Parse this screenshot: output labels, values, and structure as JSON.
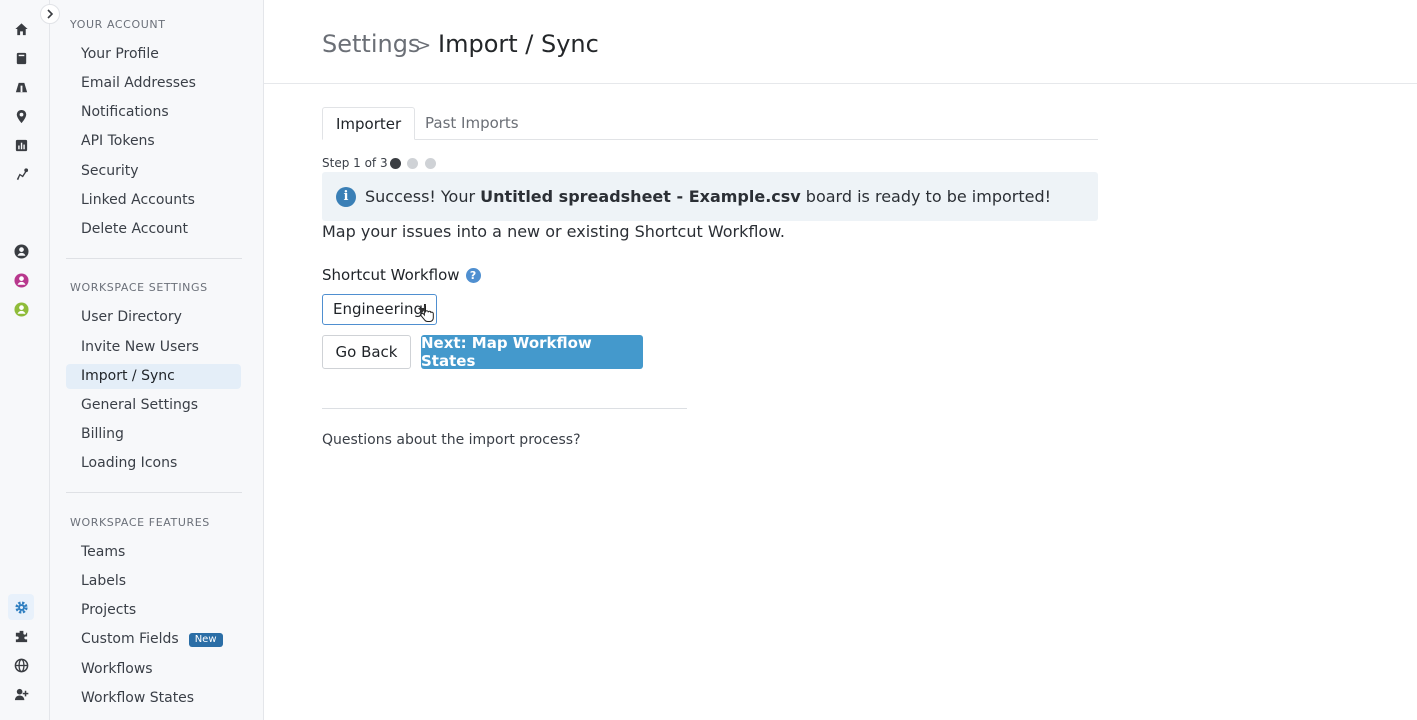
{
  "rail": {
    "icons": [
      "home-icon",
      "stories-icon",
      "epics-icon",
      "milestones-icon",
      "reports-icon",
      "roadmap-icon",
      "team-user-icon",
      "pink-user-icon",
      "green-user-icon",
      "settings-icon",
      "integrations-icon",
      "globe-icon",
      "invite-user-icon"
    ],
    "active_icon": "settings-icon"
  },
  "sidebar": {
    "your_account": {
      "title": "YOUR ACCOUNT",
      "items": [
        "Your Profile",
        "Email Addresses",
        "Notifications",
        "API Tokens",
        "Security",
        "Linked Accounts",
        "Delete Account"
      ]
    },
    "workspace_settings": {
      "title": "WORKSPACE SETTINGS",
      "items": [
        "User Directory",
        "Invite New Users",
        "Import / Sync",
        "General Settings",
        "Billing",
        "Loading Icons"
      ],
      "active": "Import / Sync"
    },
    "workspace_features": {
      "title": "WORKSPACE FEATURES",
      "items": [
        "Teams",
        "Labels",
        "Projects",
        "Custom Fields",
        "Workflows",
        "Workflow States"
      ],
      "badge": "New"
    }
  },
  "header": {
    "breadcrumb_root": "Settings",
    "breadcrumb_sep": ">",
    "breadcrumb_current": "Import / Sync"
  },
  "tabs": [
    {
      "label": "Importer",
      "active": true
    },
    {
      "label": "Past Imports",
      "active": false
    }
  ],
  "step": {
    "label": "Step 1 of 3",
    "current": 1,
    "total": 3
  },
  "alert": {
    "prefix": "Success! Your ",
    "filename": "Untitled spreadsheet - Example.csv",
    "suffix": " board is ready to be imported!"
  },
  "intro": "Map your issues into a new or existing Shortcut Workflow.",
  "workflow": {
    "label": "Shortcut Workflow",
    "help": "?",
    "selected": "Engineering"
  },
  "buttons": {
    "back": "Go Back",
    "next": "Next: Map Workflow States"
  },
  "footer_question": "Questions about the import process?",
  "colors": {
    "accent": "#4499cc",
    "active_nav_bg": "#e4eef8",
    "badge": "#2b6ea6",
    "alert_bg": "#eef3f7"
  }
}
